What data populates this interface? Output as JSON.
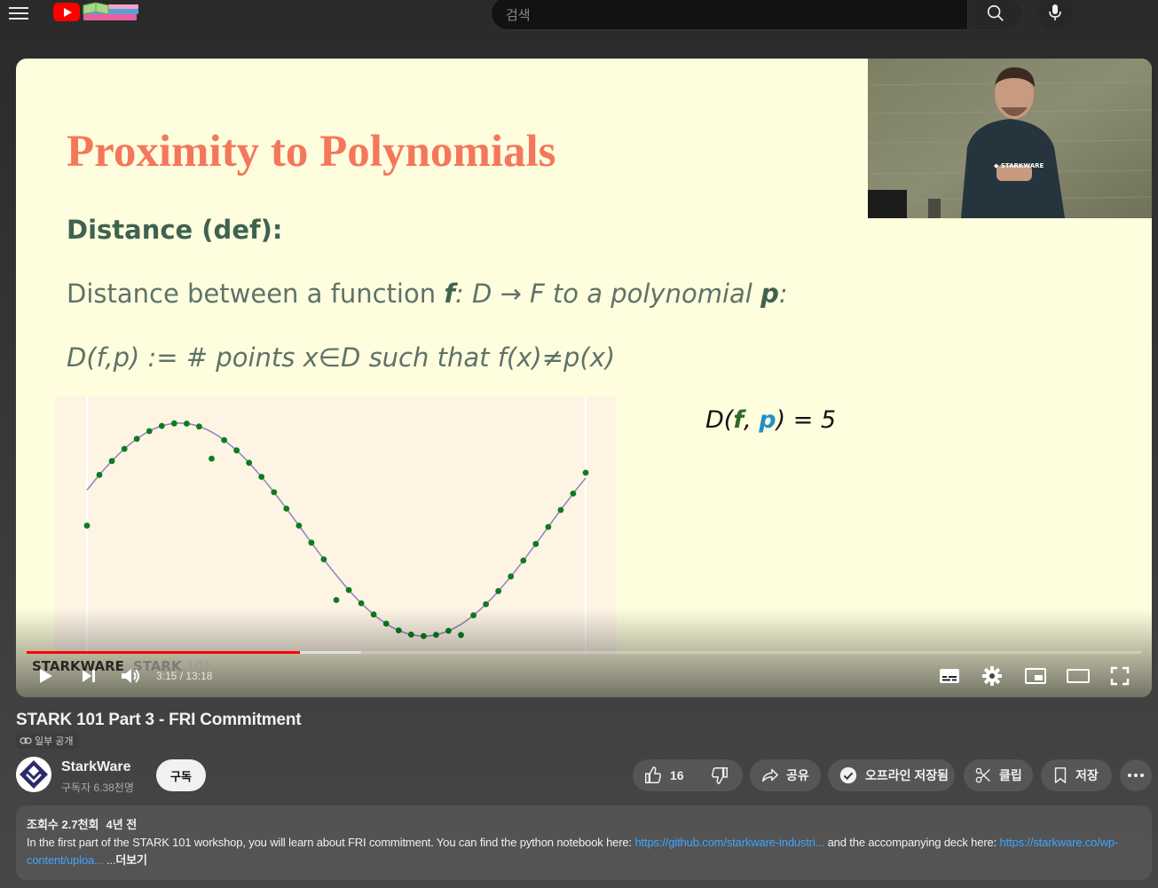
{
  "header": {
    "search_placeholder": "검색"
  },
  "slide": {
    "title": "Proximity to Polynomials",
    "subtitle": "Distance (def):",
    "line1_pre": "Distance between a function ",
    "line1_f": "f",
    "line1_mid": ": D → F to a polynomial ",
    "line1_p": "p",
    "line1_end": ":",
    "line2": "D(f,p)  := # points x∈D  such that f(x)≠p(x)",
    "eq_pre": "D(",
    "eq_f": "f",
    "eq_sep": ", ",
    "eq_p": "p",
    "eq_post": ") = 5",
    "watermark_brand": "STARKWARE",
    "watermark_series": "STARK",
    "watermark_series_num": "101"
  },
  "player": {
    "time_display": "3:15 / 13:18",
    "played_fraction": 0.245,
    "buffered_fraction": 0.3
  },
  "video": {
    "title": "STARK 101 Part 3 - FRI Commitment",
    "visibility": "일부 공개",
    "channel_name": "StarkWare",
    "subscribers": "구독자 6.38천명",
    "subscribe_label": "구독",
    "like_count": "16",
    "share_label": "공유",
    "offline_label": "오프라인 저장됨",
    "clip_label": "클립",
    "save_label": "저장"
  },
  "description": {
    "views": "조회수 2.7천회",
    "age": "4년 전",
    "text1": "In the first part of the STARK 101 workshop, you will learn about FRI commitment. You can find the python notebook here: ",
    "link1": "https://github.com/starkware-industri...",
    "text2": " and the accompanying deck here: ",
    "link2": "https://starkware.co/wp-content/uploa...",
    "text3": " ...",
    "more_label": "더보기"
  },
  "colors": {
    "accent_red": "#ff0000",
    "slide_title": "#f4775b",
    "slide_green": "#3f6350",
    "link_blue": "#3ea6ff"
  }
}
